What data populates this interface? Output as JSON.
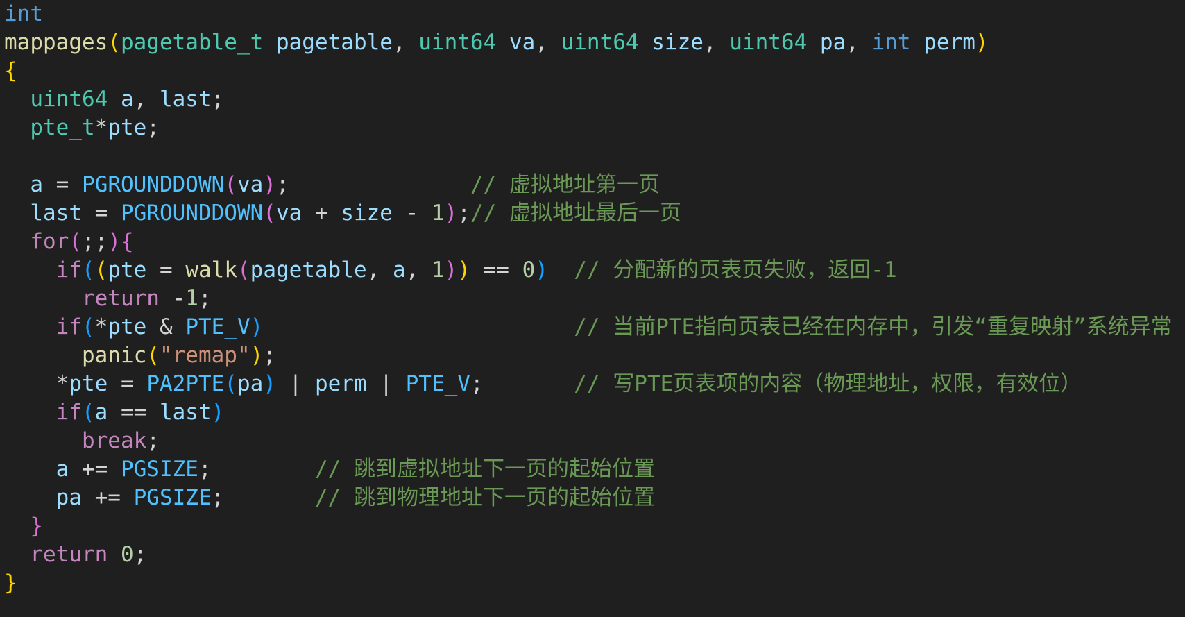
{
  "editor": {
    "language": "c",
    "theme_colors": {
      "background": "#1f1f1f",
      "keyword": "#569cd6",
      "control": "#c586c0",
      "type": "#4ec9b0",
      "function": "#dcdcaa",
      "variable": "#9cdcfe",
      "macro": "#4fc1ff",
      "number": "#b5cea8",
      "string": "#ce9178",
      "comment": "#6a9955",
      "bracket_1": "#ffd700",
      "bracket_2": "#da70d6",
      "bracket_3": "#179fff"
    },
    "lines": [
      [
        [
          "kw",
          "int"
        ]
      ],
      [
        [
          "fn",
          "mappages"
        ],
        [
          "p1",
          "("
        ],
        [
          "ty",
          "pagetable_t"
        ],
        [
          "var",
          " pagetable"
        ],
        [
          "",
          ","
        ],
        [
          "ty",
          " uint64"
        ],
        [
          "var",
          " va"
        ],
        [
          "",
          ","
        ],
        [
          "ty",
          " uint64"
        ],
        [
          "var",
          " size"
        ],
        [
          "",
          ","
        ],
        [
          "ty",
          " uint64"
        ],
        [
          "var",
          " pa"
        ],
        [
          "",
          ","
        ],
        [
          "kw",
          " int"
        ],
        [
          "var",
          " perm"
        ],
        [
          "p1",
          ")"
        ]
      ],
      [
        [
          "p1",
          "{"
        ]
      ],
      [
        [
          "",
          "  "
        ],
        [
          "ty",
          "uint64"
        ],
        [
          "var",
          " a"
        ],
        [
          "",
          ","
        ],
        [
          "var",
          " last"
        ],
        [
          "",
          ";"
        ]
      ],
      [
        [
          "",
          "  "
        ],
        [
          "ty",
          "pte_t"
        ],
        [
          "",
          "",
          " "
        ],
        [
          "",
          "*"
        ],
        [
          "var",
          "pte"
        ],
        [
          "",
          ";"
        ]
      ],
      [],
      [
        [
          "",
          "  "
        ],
        [
          "var",
          "a"
        ],
        [
          "",
          " = "
        ],
        [
          "mac",
          "PGROUNDDOWN"
        ],
        [
          "p2",
          "("
        ],
        [
          "var",
          "va"
        ],
        [
          "p2",
          ")"
        ],
        [
          "",
          ";"
        ],
        [
          "",
          "              "
        ],
        [
          "cm",
          "// 虚拟地址第一页"
        ]
      ],
      [
        [
          "",
          "  "
        ],
        [
          "var",
          "last"
        ],
        [
          "",
          " = "
        ],
        [
          "mac",
          "PGROUNDDOWN"
        ],
        [
          "p2",
          "("
        ],
        [
          "var",
          "va"
        ],
        [
          "",
          " + "
        ],
        [
          "var",
          "size"
        ],
        [
          "",
          " - "
        ],
        [
          "num",
          "1"
        ],
        [
          "p2",
          ")"
        ],
        [
          "",
          ";"
        ],
        [
          "cm",
          "// 虚拟地址最后一页"
        ]
      ],
      [
        [
          "",
          "  "
        ],
        [
          "ctl",
          "for"
        ],
        [
          "p2",
          "("
        ],
        [
          "",
          ";;"
        ],
        [
          "p2",
          ")"
        ],
        [
          "p2",
          "{"
        ]
      ],
      [
        [
          "",
          "    "
        ],
        [
          "ctl",
          "if"
        ],
        [
          "p3",
          "("
        ],
        [
          "p1",
          "("
        ],
        [
          "var",
          "pte"
        ],
        [
          "",
          " = "
        ],
        [
          "fn",
          "walk"
        ],
        [
          "p2",
          "("
        ],
        [
          "var",
          "pagetable"
        ],
        [
          "",
          ", "
        ],
        [
          "var",
          "a"
        ],
        [
          "",
          ", "
        ],
        [
          "num",
          "1"
        ],
        [
          "p2",
          ")"
        ],
        [
          "p1",
          ")"
        ],
        [
          "",
          " == "
        ],
        [
          "num",
          "0"
        ],
        [
          "p3",
          ")"
        ],
        [
          "",
          "  "
        ],
        [
          "cm",
          "// 分配新的页表页失败，返回-1"
        ]
      ],
      [
        [
          "",
          "      "
        ],
        [
          "ctl",
          "return"
        ],
        [
          "",
          " -"
        ],
        [
          "num",
          "1"
        ],
        [
          "",
          ";"
        ]
      ],
      [
        [
          "",
          "    "
        ],
        [
          "ctl",
          "if"
        ],
        [
          "p3",
          "("
        ],
        [
          "",
          "*"
        ],
        [
          "var",
          "pte"
        ],
        [
          "",
          " & "
        ],
        [
          "mac",
          "PTE_V"
        ],
        [
          "p3",
          ")"
        ],
        [
          "",
          "                        "
        ],
        [
          "cm",
          "// 当前PTE指向页表已经在内存中，引发“重复映射”系统异常"
        ]
      ],
      [
        [
          "",
          "      "
        ],
        [
          "fn",
          "panic"
        ],
        [
          "p1",
          "("
        ],
        [
          "str",
          "\"remap\""
        ],
        [
          "p1",
          ")"
        ],
        [
          "",
          ";"
        ]
      ],
      [
        [
          "",
          "    "
        ],
        [
          "",
          "*"
        ],
        [
          "var",
          "pte"
        ],
        [
          "",
          " = "
        ],
        [
          "mac",
          "PA2PTE"
        ],
        [
          "p3",
          "("
        ],
        [
          "var",
          "pa"
        ],
        [
          "p3",
          ")"
        ],
        [
          "",
          " | "
        ],
        [
          "var",
          "perm"
        ],
        [
          "",
          " | "
        ],
        [
          "mac",
          "PTE_V"
        ],
        [
          "",
          ";"
        ],
        [
          "",
          "       "
        ],
        [
          "cm",
          "// 写PTE页表项的内容（物理地址，权限，有效位）"
        ]
      ],
      [
        [
          "",
          "    "
        ],
        [
          "ctl",
          "if"
        ],
        [
          "p3",
          "("
        ],
        [
          "var",
          "a"
        ],
        [
          "",
          " == "
        ],
        [
          "var",
          "last"
        ],
        [
          "p3",
          ")"
        ]
      ],
      [
        [
          "",
          "      "
        ],
        [
          "ctl",
          "break"
        ],
        [
          "",
          ";"
        ]
      ],
      [
        [
          "",
          "    "
        ],
        [
          "var",
          "a"
        ],
        [
          "",
          " += "
        ],
        [
          "mac",
          "PGSIZE"
        ],
        [
          "",
          ";"
        ],
        [
          "",
          "        "
        ],
        [
          "cm",
          "// 跳到虚拟地址下一页的起始位置"
        ]
      ],
      [
        [
          "",
          "    "
        ],
        [
          "var",
          "pa"
        ],
        [
          "",
          " += "
        ],
        [
          "mac",
          "PGSIZE"
        ],
        [
          "",
          ";"
        ],
        [
          "",
          "       "
        ],
        [
          "cm",
          "// 跳到物理地址下一页的起始位置"
        ]
      ],
      [
        [
          "",
          "  "
        ],
        [
          "p2",
          "}"
        ]
      ],
      [
        [
          "",
          "  "
        ],
        [
          "ctl",
          "return"
        ],
        [
          "",
          " "
        ],
        [
          "num",
          "0"
        ],
        [
          "",
          ";"
        ]
      ],
      [
        [
          "p1",
          "}"
        ]
      ]
    ]
  }
}
